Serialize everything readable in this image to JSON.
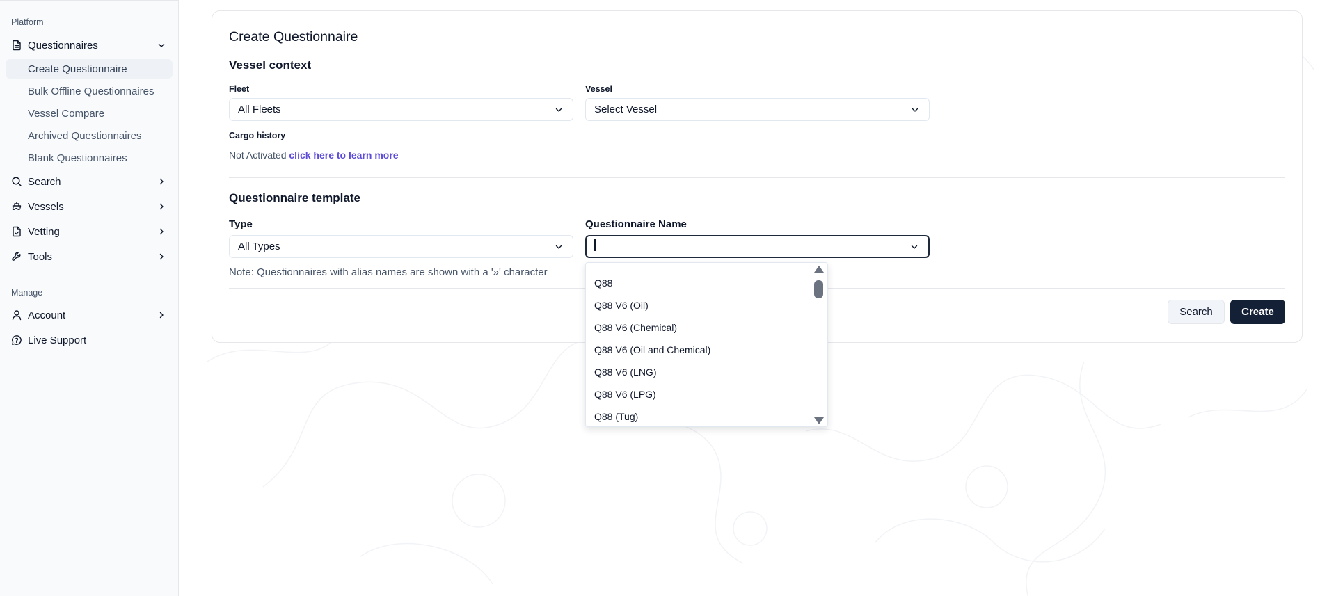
{
  "sidebar": {
    "platform_label": "Platform",
    "manage_label": "Manage",
    "questionnaires": "Questionnaires",
    "sub_items": [
      "Create Questionnaire",
      "Bulk Offline Questionnaires",
      "Vessel Compare",
      "Archived Questionnaires",
      "Blank Questionnaires"
    ],
    "search": "Search",
    "vessels": "Vessels",
    "vetting": "Vetting",
    "tools": "Tools",
    "account": "Account",
    "live_support": "Live Support"
  },
  "form": {
    "title": "Create Questionnaire",
    "vessel_context_heading": "Vessel context",
    "fleet_label": "Fleet",
    "fleet_value": "All Fleets",
    "vessel_label": "Vessel",
    "vessel_value": "Select Vessel",
    "cargo_label": "Cargo history",
    "cargo_status": "Not Activated",
    "cargo_link": "click here to learn more",
    "template_heading": "Questionnaire template",
    "type_label": "Type",
    "type_value": "All Types",
    "name_label": "Questionnaire Name",
    "name_value": "",
    "note": "Note: Questionnaires with alias names are shown with a '»' character",
    "search_button": "Search",
    "create_button": "Create"
  },
  "dropdown": {
    "options": [
      "Q88",
      "Q88 V6 (Oil)",
      "Q88 V6 (Chemical)",
      "Q88 V6 (Oil and Chemical)",
      "Q88 V6 (LNG)",
      "Q88 V6 (LPG)",
      "Q88 (Tug)"
    ]
  },
  "colors": {
    "primary_button": "#142036",
    "link": "#5b4bd8",
    "sidebar_bg": "#f8fafc",
    "active_item_bg": "#eef2f6"
  }
}
